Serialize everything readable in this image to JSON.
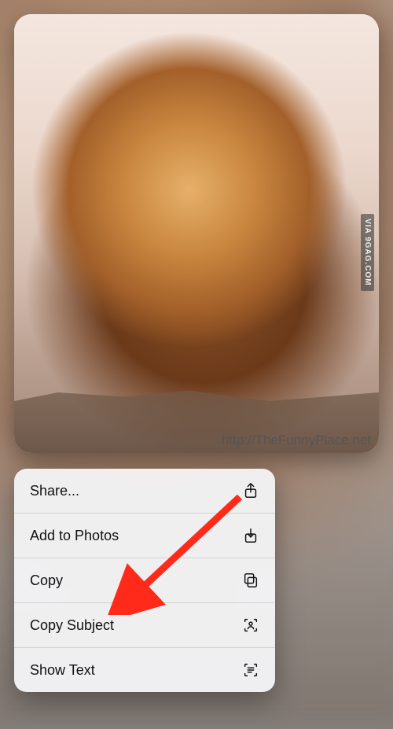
{
  "preview": {
    "side_watermark": "VIA 9GAG.COM",
    "bottom_watermark": "http://TheFunnyPlace.net"
  },
  "menu": {
    "items": [
      {
        "label": "Share...",
        "icon": "share-icon"
      },
      {
        "label": "Add to Photos",
        "icon": "download-icon"
      },
      {
        "label": "Copy",
        "icon": "copy-icon"
      },
      {
        "label": "Copy Subject",
        "icon": "subject-icon"
      },
      {
        "label": "Show Text",
        "icon": "live-text-icon"
      }
    ]
  }
}
